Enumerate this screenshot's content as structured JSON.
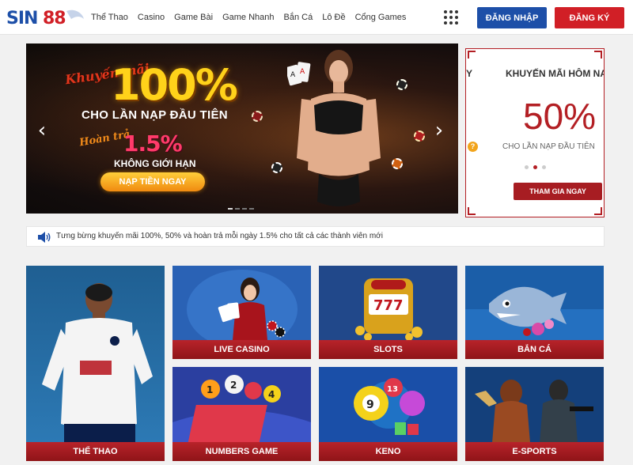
{
  "header": {
    "logo_text": "SIN88",
    "nav": [
      "Thể Thao",
      "Casino",
      "Game Bài",
      "Game Nhanh",
      "Bắn Cá",
      "Lô Đề",
      "Cổng Games"
    ],
    "login_label": "ĐĂNG NHẬP",
    "register_label": "ĐĂNG KÝ",
    "colors": {
      "login": "#1d4fa8",
      "register": "#d11f26"
    }
  },
  "banner": {
    "script_line": "Khuyến mãi",
    "big_value": "100%",
    "sub_line": "CHO LẦN NẠP ĐẦU TIÊN",
    "script_line2": "Hoàn trả",
    "rebate_value": "1.5%",
    "no_limit": "KHÔNG GIỚI HẠN",
    "cta_label": "NẠP TIỀN NGAY",
    "prev_arrow": "‹",
    "next_arrow": "›",
    "slides": 4,
    "active_slide": 1
  },
  "side_promo": {
    "title": "KHUYẾN MÃI HÔM NA",
    "prev_title_fragment": "Y",
    "big_value": "50%",
    "sub_line": "CHO LẦN NẠP ĐẦU TIÊN",
    "help_icon": "?",
    "slides": 3,
    "active_slide": 2,
    "cta_label": "THAM GIA NGAY"
  },
  "marquee": {
    "icon": "speaker-icon",
    "text": "Tưng bừng khuyến mãi 100%, 50% và hoàn trả mỗi ngày 1.5% cho tất cả các thành viên mới"
  },
  "games": {
    "sports": "THỂ THAO",
    "live_casino": "LIVE CASINO",
    "slots": "SLOTS",
    "ban_ca": "BẮN CÁ",
    "numbers": "NUMBERS GAME",
    "keno": "KENO",
    "esports": "E-SPORTS"
  }
}
